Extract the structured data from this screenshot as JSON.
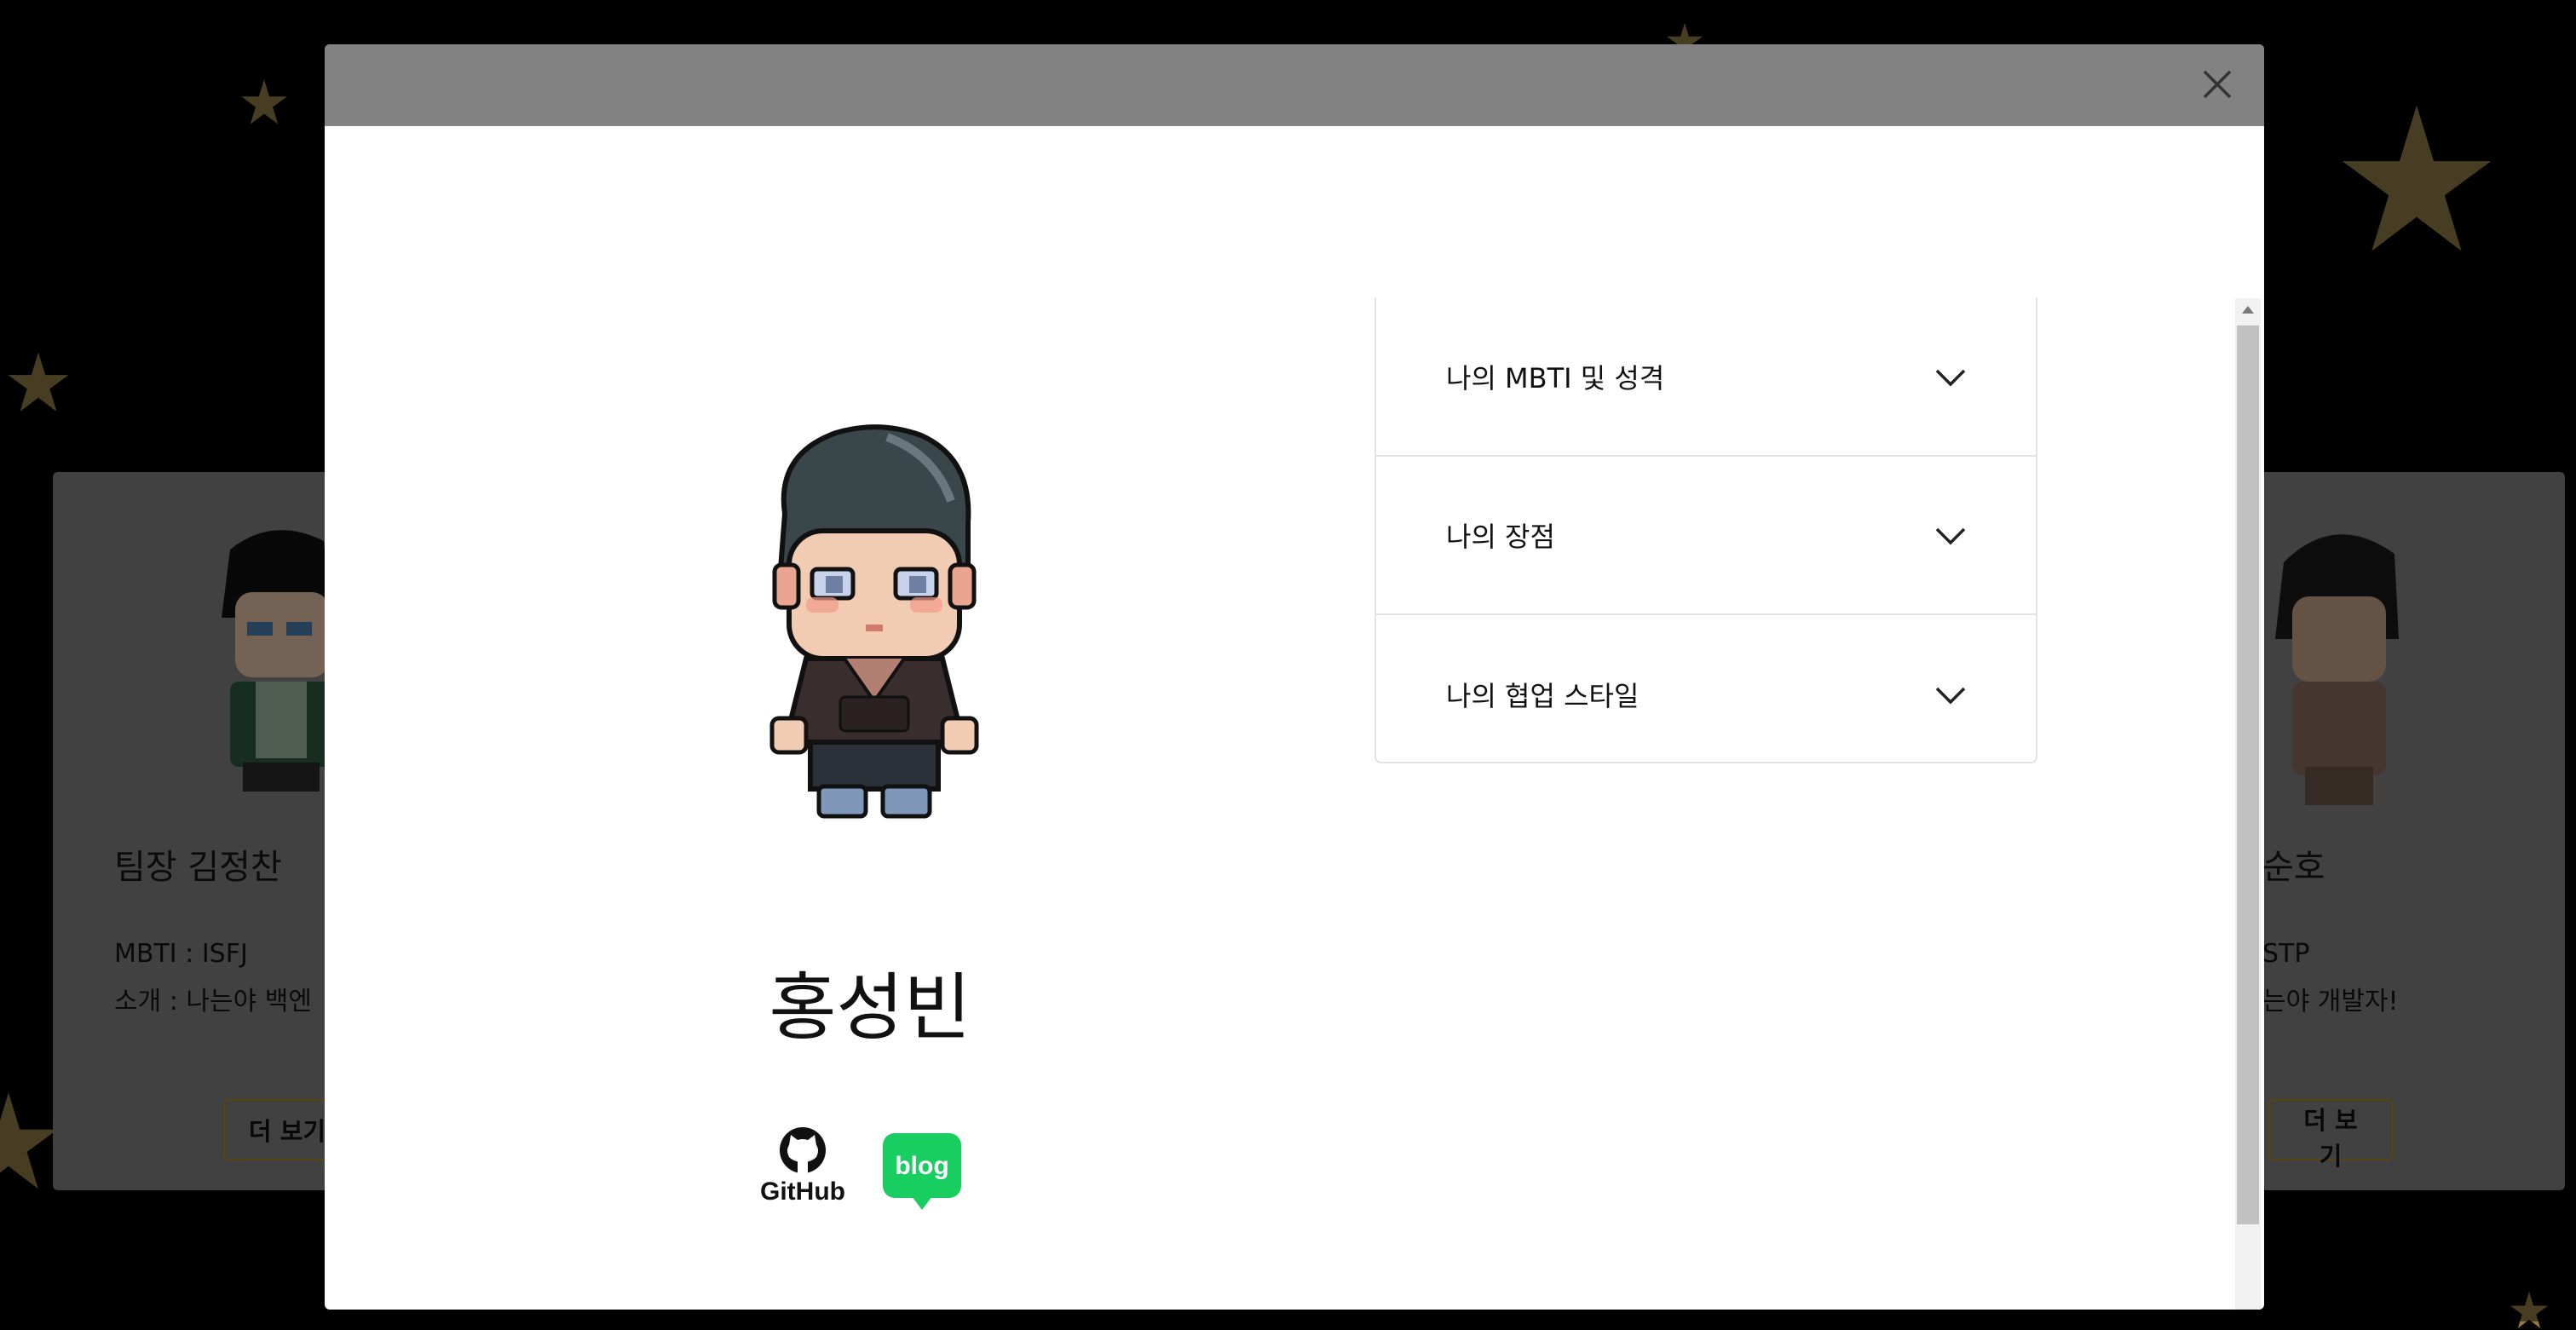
{
  "background": {
    "left_card": {
      "name": "팀장 김정찬",
      "mbti": "MBTI : ISFJ",
      "intro": "소개 : 나는야 백엔",
      "button": "더 보기"
    },
    "right_card": {
      "name": "순호",
      "mbti": "STP",
      "intro": "는야 개발자!",
      "button": "더 보기"
    },
    "star_color": "#8f7a44"
  },
  "modal": {
    "header_color": "#828282",
    "close_icon": "close-icon",
    "profile": {
      "name": "홍성빈",
      "avatar_icon": "pixel-avatar",
      "github_label": "GitHub",
      "blog_label": "blog",
      "blog_color": "#19ce60"
    },
    "accordion": [
      {
        "title": "나의 MBTI 및 성격",
        "icon": "chevron-down-icon"
      },
      {
        "title": "나의 장점",
        "icon": "chevron-down-icon"
      },
      {
        "title": "나의 협업 스타일",
        "icon": "chevron-down-icon"
      }
    ]
  }
}
